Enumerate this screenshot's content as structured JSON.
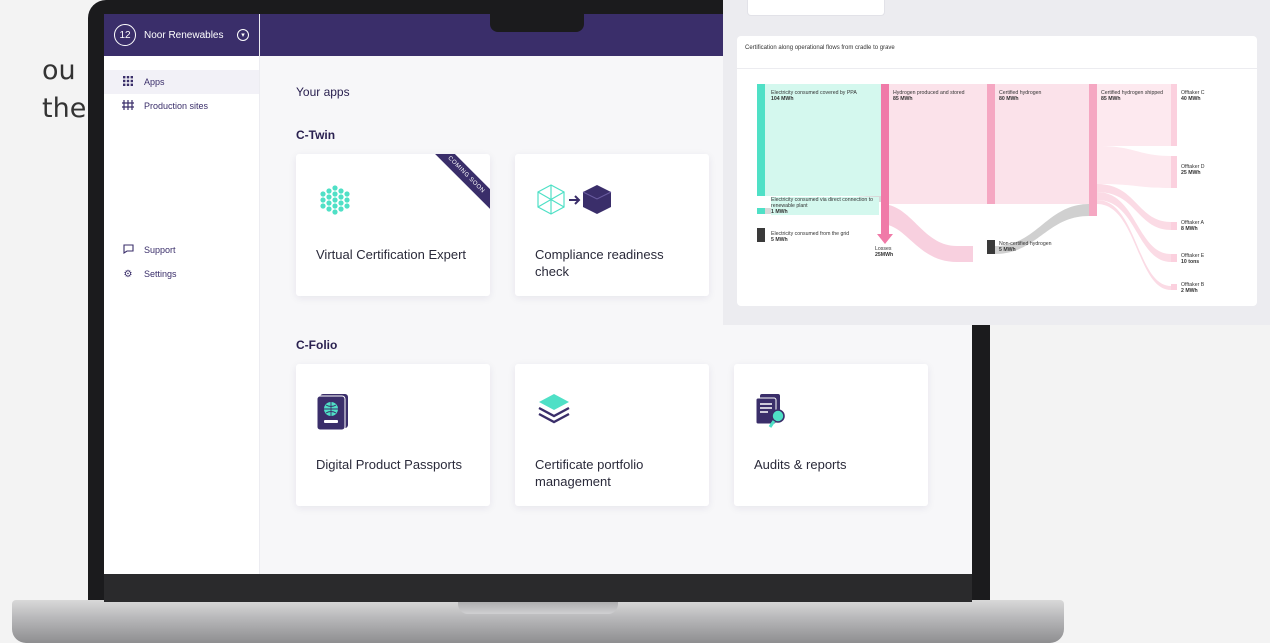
{
  "side_text": [
    "ou",
    "the"
  ],
  "sidebar": {
    "logo": "12",
    "org_name": "Noor Renewables",
    "items": [
      {
        "label": "Apps",
        "icon": "grid-icon"
      },
      {
        "label": "Production sites",
        "icon": "towers-icon"
      }
    ],
    "bottom_items": [
      {
        "label": "Support",
        "icon": "chat-icon"
      },
      {
        "label": "Settings",
        "icon": "gear-icon"
      }
    ]
  },
  "main": {
    "heading": "Your apps",
    "sections": [
      {
        "title": "C-Twin",
        "apps": [
          {
            "label": "Virtual Certification Expert",
            "icon": "cube-grid-icon",
            "ribbon": "COMING SOON"
          },
          {
            "label": "Compliance readiness check",
            "icon": "cube-transform-icon"
          }
        ]
      },
      {
        "title": "C-Folio",
        "apps": [
          {
            "label": "Digital Product Passports",
            "icon": "passport-icon"
          },
          {
            "label": "Certificate portfolio management",
            "icon": "layers-icon"
          },
          {
            "label": "Audits & reports",
            "icon": "report-search-icon"
          }
        ]
      }
    ]
  },
  "overlay": {
    "title": "Certification along operational flows from cradle to grave",
    "nodes": {
      "ppa": {
        "label": "Electricity consumed covered by PPA",
        "value": "104 MWh"
      },
      "direct": {
        "label": "Electricity consumed via direct connection to renewable plant",
        "value": "1 MWh"
      },
      "grid": {
        "label": "Electricity consumed from the grid",
        "value": "5 MWh"
      },
      "hydrogen": {
        "label": "Hydrogen produced and stored",
        "value": "85 MWh"
      },
      "losses": {
        "label": "Losses",
        "value": "25MWh"
      },
      "certified": {
        "label": "Certified hydrogen",
        "value": "80 MWh"
      },
      "noncertified": {
        "label": "Non-certified hydrogen",
        "value": "5 MWh"
      },
      "shipped": {
        "label": "Certified hydrogen shipped",
        "value": "85 MWh"
      },
      "offtaker_c": {
        "label": "Offtaker C",
        "value": "40 MWh"
      },
      "offtaker_d": {
        "label": "Offtaker D",
        "value": "25 MWh"
      },
      "offtaker_a": {
        "label": "Offtaker A",
        "value": "8 MWh"
      },
      "offtaker_e": {
        "label": "Offtaker E",
        "value": "10 tons"
      },
      "offtaker_b": {
        "label": "Offtaker B",
        "value": "2 MWh"
      }
    }
  },
  "colors": {
    "brand": "#3a2e6a",
    "teal": "#4fe0c6",
    "pink": "#f07aa8",
    "pink_light": "#fbe2ea"
  }
}
